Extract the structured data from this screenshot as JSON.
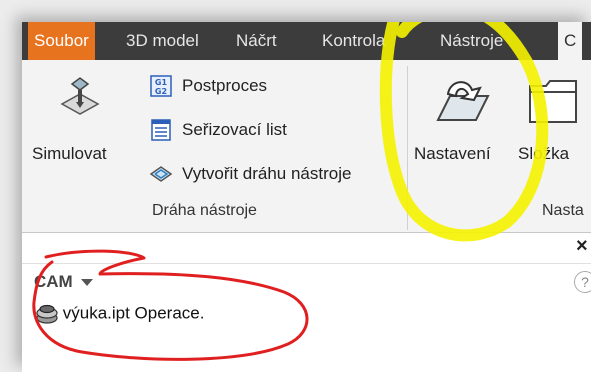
{
  "tabs": [
    {
      "label": "Soubor"
    },
    {
      "label": "3D model"
    },
    {
      "label": "Náčrt"
    },
    {
      "label": "Kontrola"
    },
    {
      "label": "Nástroje"
    },
    {
      "label": "C"
    }
  ],
  "ribbon": {
    "simulate": {
      "label": "Simulovat",
      "icon": "simulate-icon"
    },
    "postprocess": {
      "label": "Postproces",
      "icon": "g1g2-icon"
    },
    "setup_sheet": {
      "label": "Seřizovací list",
      "icon": "sheet-icon"
    },
    "generate_toolpath": {
      "label": "Vytvořit dráhu nástroje",
      "icon": "toolpath-icon"
    },
    "group_toolpath": "Dráha nástroje",
    "setup": {
      "label": "Nastavení",
      "icon": "setup-icon"
    },
    "folder": {
      "label": "Složka",
      "icon": "folder-icon"
    },
    "group_setup": "Nasta"
  },
  "browser": {
    "close_glyph": "×",
    "help_glyph": "?",
    "title": "CAM",
    "node_label": "výuka.ipt Operace."
  },
  "colors": {
    "file_tab": "#e8731f",
    "tabbar": "#3c3c3c",
    "ribbon": "#f3f3f3",
    "highlight_yellow": "#f5f200",
    "highlight_red": "#e02020"
  }
}
